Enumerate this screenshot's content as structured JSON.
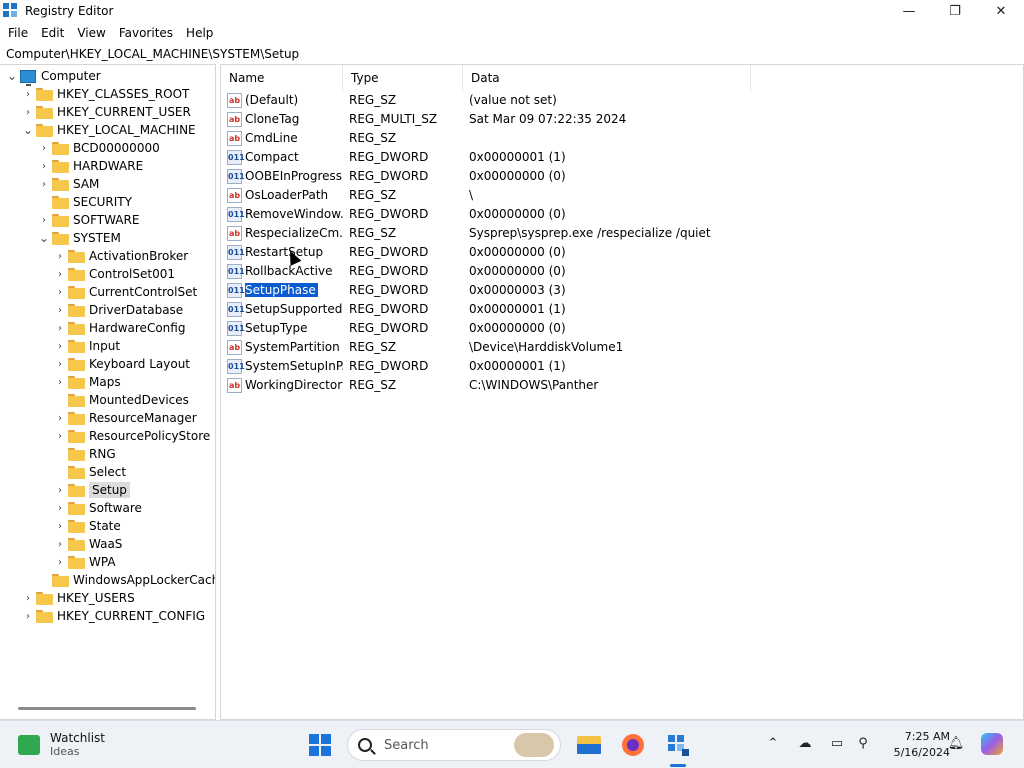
{
  "window": {
    "title": "Registry Editor",
    "minimize": "—",
    "maximize": "❐",
    "close": "✕"
  },
  "menu": [
    "File",
    "Edit",
    "View",
    "Favorites",
    "Help"
  ],
  "address": "Computer\\HKEY_LOCAL_MACHINE\\SYSTEM\\Setup",
  "tree": [
    {
      "label": "Computer",
      "depth": 0,
      "expanded": true,
      "icon": "computer-icon"
    },
    {
      "label": "HKEY_CLASSES_ROOT",
      "depth": 1,
      "expanded": false
    },
    {
      "label": "HKEY_CURRENT_USER",
      "depth": 1,
      "expanded": false
    },
    {
      "label": "HKEY_LOCAL_MACHINE",
      "depth": 1,
      "expanded": true
    },
    {
      "label": "BCD00000000",
      "depth": 2,
      "expanded": false
    },
    {
      "label": "HARDWARE",
      "depth": 2,
      "expanded": false
    },
    {
      "label": "SAM",
      "depth": 2,
      "expanded": false
    },
    {
      "label": "SECURITY",
      "depth": 2,
      "leaf": true
    },
    {
      "label": "SOFTWARE",
      "depth": 2,
      "expanded": false
    },
    {
      "label": "SYSTEM",
      "depth": 2,
      "expanded": true
    },
    {
      "label": "ActivationBroker",
      "depth": 3,
      "expanded": false
    },
    {
      "label": "ControlSet001",
      "depth": 3,
      "expanded": false
    },
    {
      "label": "CurrentControlSet",
      "depth": 3,
      "expanded": false
    },
    {
      "label": "DriverDatabase",
      "depth": 3,
      "expanded": false
    },
    {
      "label": "HardwareConfig",
      "depth": 3,
      "expanded": false
    },
    {
      "label": "Input",
      "depth": 3,
      "expanded": false
    },
    {
      "label": "Keyboard Layout",
      "depth": 3,
      "expanded": false
    },
    {
      "label": "Maps",
      "depth": 3,
      "expanded": false
    },
    {
      "label": "MountedDevices",
      "depth": 3,
      "leaf": true
    },
    {
      "label": "ResourceManager",
      "depth": 3,
      "expanded": false
    },
    {
      "label": "ResourcePolicyStore",
      "depth": 3,
      "expanded": false
    },
    {
      "label": "RNG",
      "depth": 3,
      "leaf": true
    },
    {
      "label": "Select",
      "depth": 3,
      "leaf": true
    },
    {
      "label": "Setup",
      "depth": 3,
      "expanded": false,
      "selected": true
    },
    {
      "label": "Software",
      "depth": 3,
      "expanded": false
    },
    {
      "label": "State",
      "depth": 3,
      "expanded": false
    },
    {
      "label": "WaaS",
      "depth": 3,
      "expanded": false
    },
    {
      "label": "WPA",
      "depth": 3,
      "expanded": false
    },
    {
      "label": "WindowsAppLockerCache",
      "depth": 2,
      "leaf": true
    },
    {
      "label": "HKEY_USERS",
      "depth": 1,
      "expanded": false
    },
    {
      "label": "HKEY_CURRENT_CONFIG",
      "depth": 1,
      "expanded": false
    }
  ],
  "columns": {
    "name": "Name",
    "type": "Type",
    "data": "Data"
  },
  "values": [
    {
      "name": "(Default)",
      "type": "REG_SZ",
      "data": "(value not set)",
      "kind": "sz"
    },
    {
      "name": "CloneTag",
      "type": "REG_MULTI_SZ",
      "data": "Sat Mar 09 07:22:35 2024",
      "kind": "sz"
    },
    {
      "name": "CmdLine",
      "type": "REG_SZ",
      "data": "",
      "kind": "sz"
    },
    {
      "name": "Compact",
      "type": "REG_DWORD",
      "data": "0x00000001 (1)",
      "kind": "dw"
    },
    {
      "name": "OOBEInProgress",
      "type": "REG_DWORD",
      "data": "0x00000000 (0)",
      "kind": "dw"
    },
    {
      "name": "OsLoaderPath",
      "type": "REG_SZ",
      "data": "\\",
      "kind": "sz"
    },
    {
      "name": "RemoveWindow...",
      "type": "REG_DWORD",
      "data": "0x00000000 (0)",
      "kind": "dw"
    },
    {
      "name": "RespecializeCm...",
      "type": "REG_SZ",
      "data": "Sysprep\\sysprep.exe /respecialize /quiet",
      "kind": "sz"
    },
    {
      "name": "RestartSetup",
      "type": "REG_DWORD",
      "data": "0x00000000 (0)",
      "kind": "dw"
    },
    {
      "name": "RollbackActive",
      "type": "REG_DWORD",
      "data": "0x00000000 (0)",
      "kind": "dw"
    },
    {
      "name": "SetupPhase",
      "type": "REG_DWORD",
      "data": "0x00000003 (3)",
      "kind": "dw",
      "selected": true
    },
    {
      "name": "SetupSupported",
      "type": "REG_DWORD",
      "data": "0x00000001 (1)",
      "kind": "dw"
    },
    {
      "name": "SetupType",
      "type": "REG_DWORD",
      "data": "0x00000000 (0)",
      "kind": "dw"
    },
    {
      "name": "SystemPartition",
      "type": "REG_SZ",
      "data": "\\Device\\HarddiskVolume1",
      "kind": "sz"
    },
    {
      "name": "SystemSetupInP...",
      "type": "REG_DWORD",
      "data": "0x00000001 (1)",
      "kind": "dw"
    },
    {
      "name": "WorkingDirectory",
      "type": "REG_SZ",
      "data": "C:\\WINDOWS\\Panther",
      "kind": "sz"
    }
  ],
  "icon_text": {
    "sz": "ab",
    "dw": "011"
  },
  "taskbar": {
    "widget_title": "Watchlist",
    "widget_sub": "Ideas",
    "search_placeholder": "Search",
    "time": "7:25 AM",
    "date": "5/16/2024"
  },
  "colors": {
    "accent": "#0b5cd1",
    "folder": "#f5c74a",
    "start": "#1a73d9"
  }
}
